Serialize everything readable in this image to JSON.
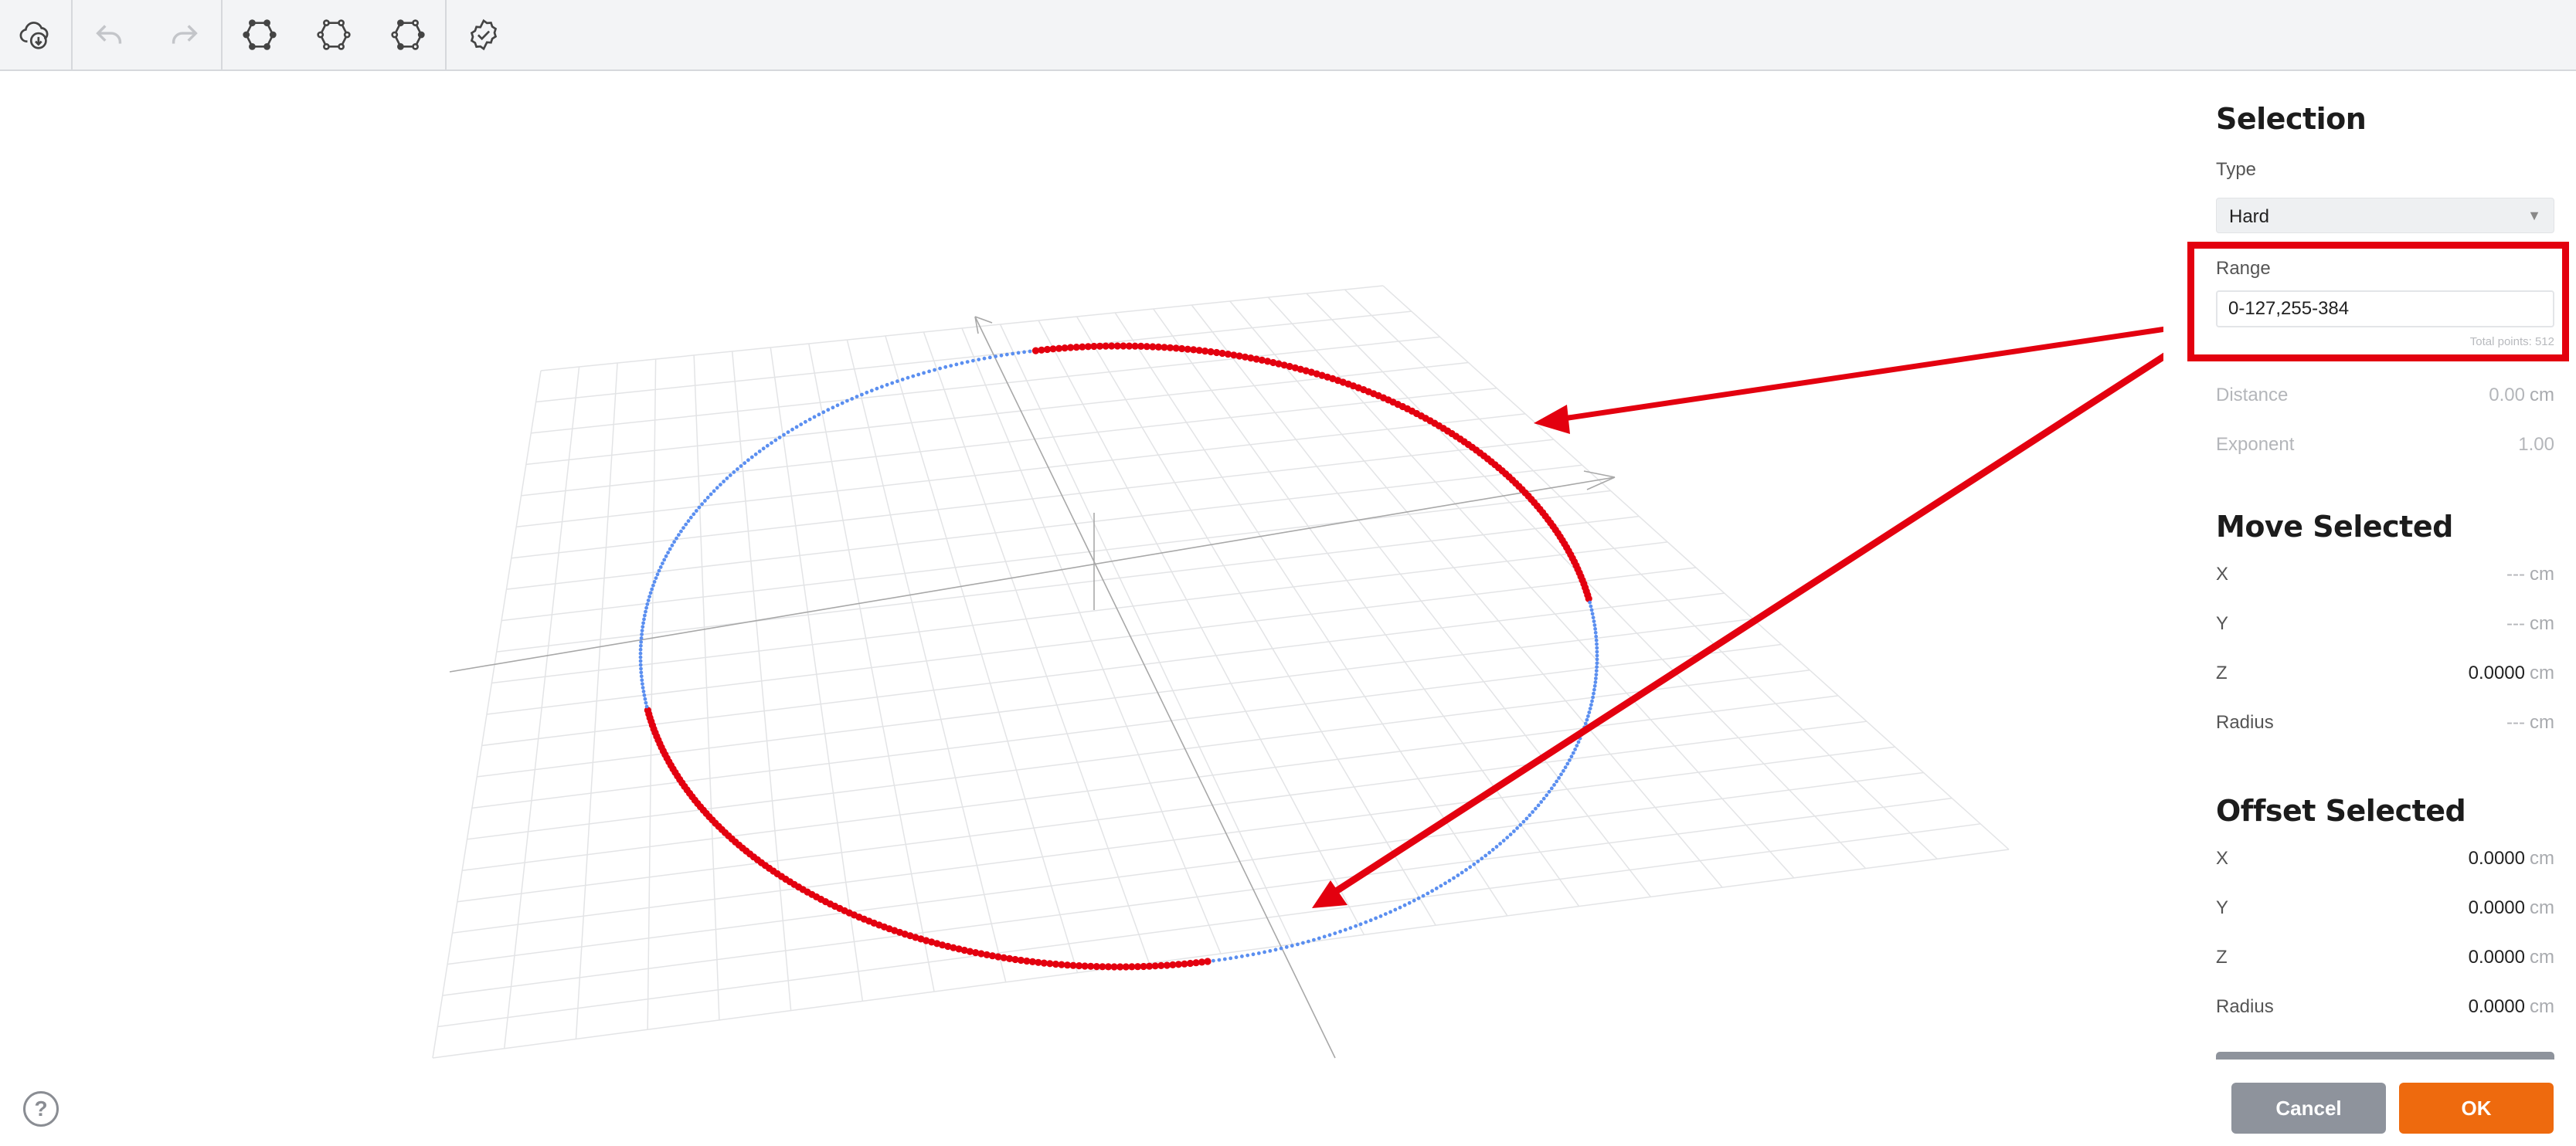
{
  "toolbar": {
    "buttons": [
      {
        "icon": "cloud-download-icon",
        "enabled": true
      },
      {
        "icon": "undo-icon",
        "enabled": false
      },
      {
        "icon": "redo-icon",
        "enabled": false
      },
      {
        "icon": "select-all-points-icon",
        "enabled": true
      },
      {
        "icon": "select-none-icon",
        "enabled": true
      },
      {
        "icon": "invert-selection-icon",
        "enabled": true
      },
      {
        "icon": "verify-icon",
        "enabled": true
      }
    ]
  },
  "viewport": {
    "selected_color": "#e3000f",
    "unselected_color": "#5b8ff0"
  },
  "selection": {
    "title": "Selection",
    "type_label": "Type",
    "type_value": "Hard",
    "range_label": "Range",
    "range_value": "0-127,255-384",
    "total_points": "Total points: 512",
    "distance_label": "Distance",
    "distance_value": "0.00",
    "distance_unit": "cm",
    "exponent_label": "Exponent",
    "exponent_value": "1.00"
  },
  "move_selected": {
    "title": "Move Selected",
    "rows": [
      {
        "label": "X",
        "value": "---",
        "unit": "cm"
      },
      {
        "label": "Y",
        "value": "---",
        "unit": "cm"
      },
      {
        "label": "Z",
        "value": "0.0000",
        "unit": "cm"
      },
      {
        "label": "Radius",
        "value": "---",
        "unit": "cm"
      }
    ]
  },
  "offset_selected": {
    "title": "Offset Selected",
    "rows": [
      {
        "label": "X",
        "value": "0.0000",
        "unit": "cm"
      },
      {
        "label": "Y",
        "value": "0.0000",
        "unit": "cm"
      },
      {
        "label": "Z",
        "value": "0.0000",
        "unit": "cm"
      },
      {
        "label": "Radius",
        "value": "0.0000",
        "unit": "cm"
      }
    ]
  },
  "footer": {
    "help_symbol": "?",
    "cancel_label": "Cancel",
    "ok_label": "OK"
  },
  "colors": {
    "accent": "#ee6a0e",
    "annotation": "#e3000f",
    "secondary_button": "#8e939c"
  }
}
